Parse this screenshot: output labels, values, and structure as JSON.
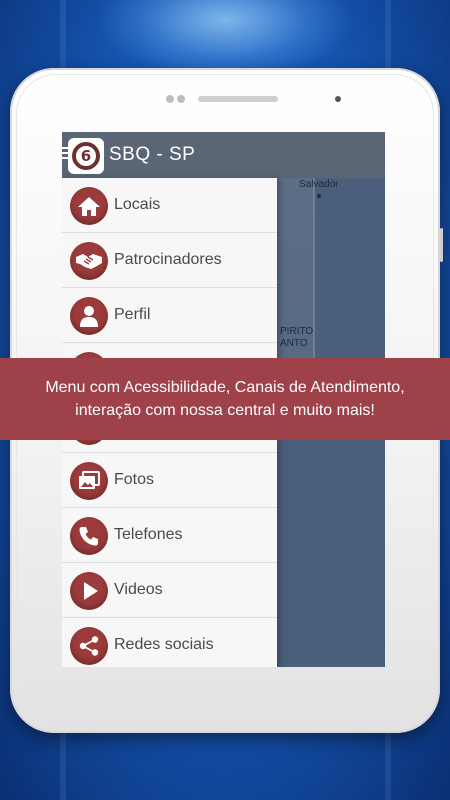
{
  "app": {
    "title": "SBQ - SP",
    "logo_mark": "6"
  },
  "map": {
    "labels": [
      "Salvador",
      "PIRITO",
      "ANTO"
    ]
  },
  "menu": {
    "items": [
      {
        "label": "Locais",
        "icon": "home-icon"
      },
      {
        "label": "Patrocinadores",
        "icon": "handshake-icon"
      },
      {
        "label": "Perfil",
        "icon": "user-icon"
      },
      {
        "label": "",
        "icon": "hidden-icon"
      },
      {
        "label": "",
        "icon": "hidden-icon"
      },
      {
        "label": "Fotos",
        "icon": "photos-icon"
      },
      {
        "label": "Telefones",
        "icon": "phone-icon"
      },
      {
        "label": "Videos",
        "icon": "play-icon"
      },
      {
        "label": "Redes sociais",
        "icon": "share-icon"
      }
    ]
  },
  "banner": {
    "line1": "Menu com Acessibilidade, Canais de Atendimento,",
    "line2": "interação com nossa central e muito mais!"
  },
  "colors": {
    "accent": "#9b3b3b",
    "banner": "#9e4149",
    "appbar": "#5a6675",
    "background": "#1659b8"
  }
}
